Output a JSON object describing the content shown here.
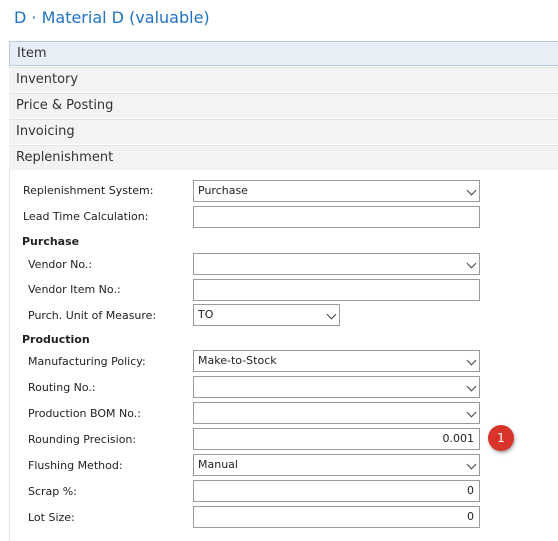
{
  "page": {
    "title": "D · Material D (valuable)"
  },
  "fasttabs": [
    {
      "label": "Item"
    },
    {
      "label": "Inventory"
    },
    {
      "label": "Price & Posting"
    },
    {
      "label": "Invoicing"
    },
    {
      "label": "Replenishment"
    }
  ],
  "replenishment": {
    "replenishment_system": {
      "label": "Replenishment System:",
      "value": "Purchase"
    },
    "lead_time_calculation": {
      "label": "Lead Time Calculation:",
      "value": ""
    },
    "purchase_group": "Purchase",
    "vendor_no": {
      "label": "Vendor No.:",
      "value": ""
    },
    "vendor_item_no": {
      "label": "Vendor Item No.:",
      "value": ""
    },
    "purch_unit_of_measure": {
      "label": "Purch. Unit of Measure:",
      "value": "TO"
    },
    "production_group": "Production",
    "manufacturing_policy": {
      "label": "Manufacturing Policy:",
      "value": "Make-to-Stock"
    },
    "routing_no": {
      "label": "Routing No.:",
      "value": ""
    },
    "production_bom_no": {
      "label": "Production BOM No.:",
      "value": ""
    },
    "rounding_precision": {
      "label": "Rounding Precision:",
      "value": "0.001"
    },
    "flushing_method": {
      "label": "Flushing Method:",
      "value": "Manual"
    },
    "scrap_pct": {
      "label": "Scrap %:",
      "value": "0"
    },
    "lot_size": {
      "label": "Lot Size:",
      "value": "0"
    }
  },
  "callout": {
    "number": "1",
    "color": "#d9342b"
  },
  "colors": {
    "title": "#1f72c0",
    "selected_tab": "#e8eef6"
  }
}
